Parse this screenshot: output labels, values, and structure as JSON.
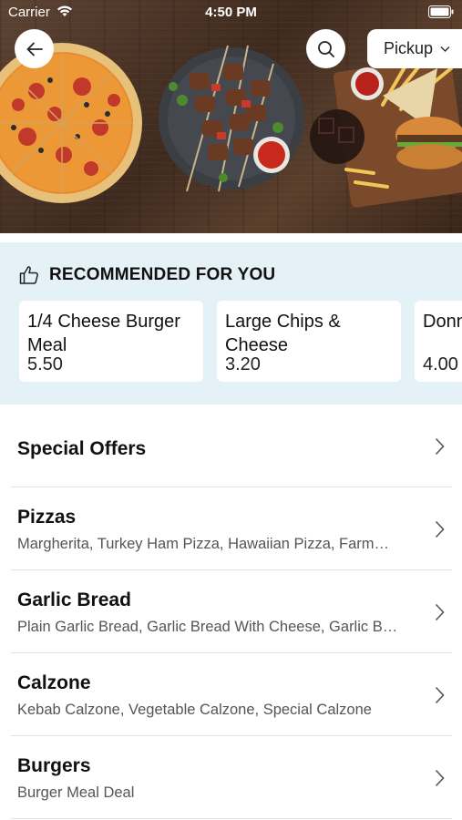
{
  "status_bar": {
    "carrier": "Carrier",
    "time": "4:50 PM"
  },
  "header": {
    "back_icon": "arrow-left-icon",
    "search_icon": "search-icon",
    "pickup_label": "Pickup",
    "pickup_chevron_icon": "chevron-down-icon"
  },
  "recommended": {
    "icon": "thumbs-up-icon",
    "title": "RECOMMENDED FOR YOU",
    "cards": [
      {
        "name": "1/4 Cheese Burger Meal",
        "price": "5.50"
      },
      {
        "name": "Large Chips & Cheese",
        "price": "3.20"
      },
      {
        "name": "Donn",
        "price": "4.00"
      }
    ]
  },
  "categories": [
    {
      "name": "Special Offers",
      "items": ""
    },
    {
      "name": "Pizzas",
      "items": "Margherita, Turkey Ham Pizza, Hawaiian Pizza, Farm…"
    },
    {
      "name": "Garlic Bread",
      "items": "Plain Garlic Bread, Garlic Bread With Cheese, Garlic B…"
    },
    {
      "name": "Calzone",
      "items": "Kebab Calzone, Vegetable Calzone, Special Calzone"
    },
    {
      "name": "Burgers",
      "items": "Burger Meal Deal"
    }
  ],
  "colors": {
    "recommended_bg": "#e4f1f6",
    "divider": "#e3e3e3",
    "subtext": "#555555"
  }
}
